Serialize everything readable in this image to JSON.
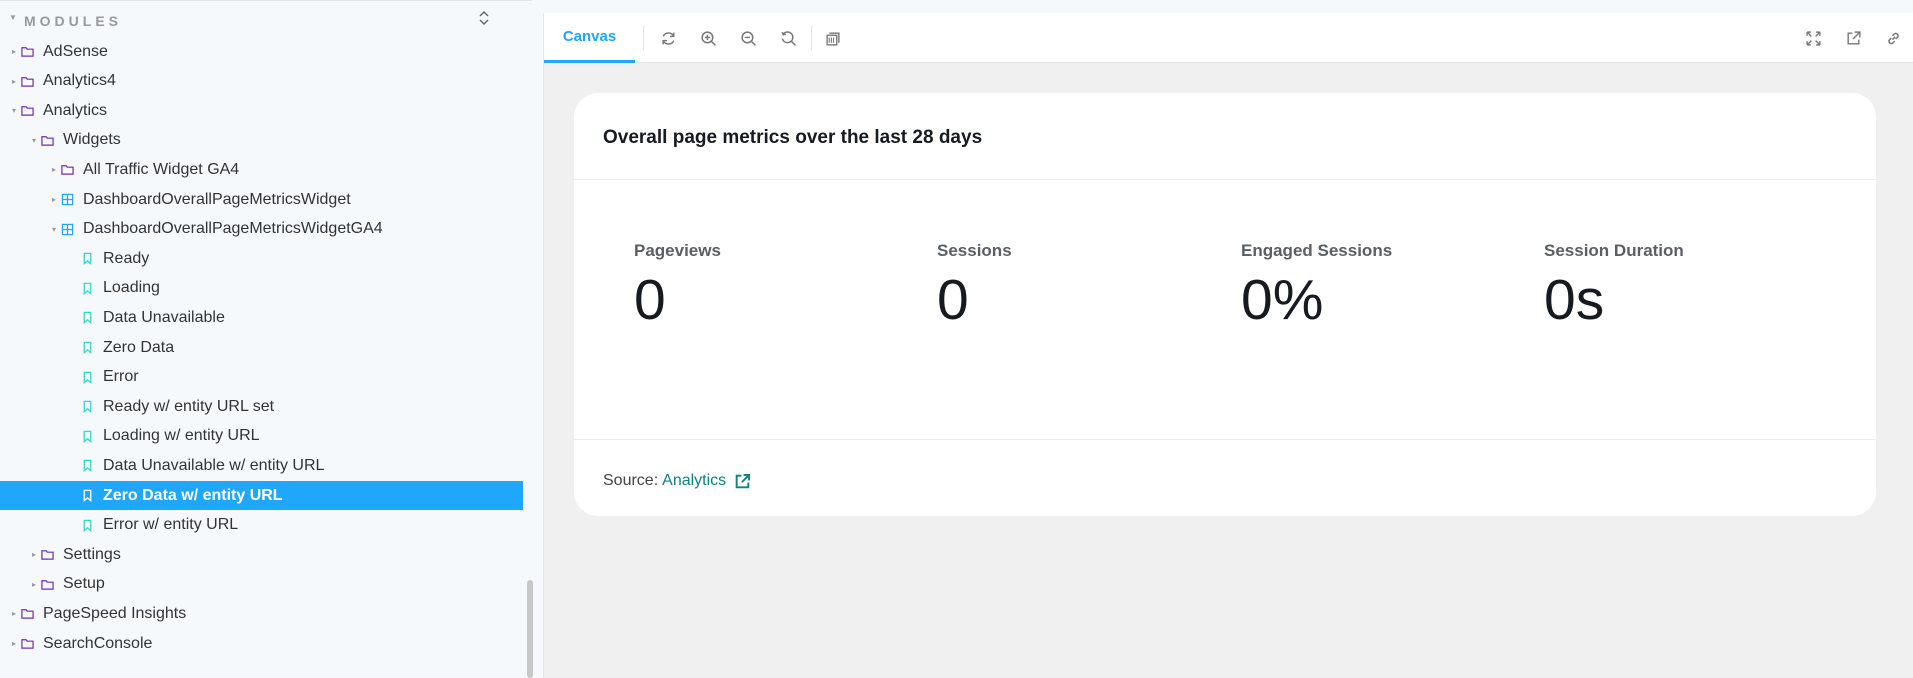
{
  "sidebar": {
    "section_title": "MODULES",
    "tree": [
      {
        "label": "AdSense",
        "icon": "folder-icon",
        "depth": 0,
        "caret": "right"
      },
      {
        "label": "Analytics4",
        "icon": "folder-icon",
        "depth": 0,
        "caret": "right"
      },
      {
        "label": "Analytics",
        "icon": "folder-icon",
        "depth": 0,
        "caret": "down"
      },
      {
        "label": "Widgets",
        "icon": "folder-icon",
        "depth": 1,
        "caret": "down"
      },
      {
        "label": "All Traffic Widget GA4",
        "icon": "folder-icon",
        "depth": 2,
        "caret": "right"
      },
      {
        "label": "DashboardOverallPageMetricsWidget",
        "icon": "component-icon",
        "depth": 2,
        "caret": "right"
      },
      {
        "label": "DashboardOverallPageMetricsWidgetGA4",
        "icon": "component-icon",
        "depth": 2,
        "caret": "down"
      },
      {
        "label": "Ready",
        "icon": "bookmark-icon",
        "depth": 3
      },
      {
        "label": "Loading",
        "icon": "bookmark-icon",
        "depth": 3
      },
      {
        "label": "Data Unavailable",
        "icon": "bookmark-icon",
        "depth": 3
      },
      {
        "label": "Zero Data",
        "icon": "bookmark-icon",
        "depth": 3
      },
      {
        "label": "Error",
        "icon": "bookmark-icon",
        "depth": 3
      },
      {
        "label": "Ready w/ entity URL set",
        "icon": "bookmark-icon",
        "depth": 3
      },
      {
        "label": "Loading w/ entity URL",
        "icon": "bookmark-icon",
        "depth": 3
      },
      {
        "label": "Data Unavailable w/ entity URL",
        "icon": "bookmark-icon",
        "depth": 3
      },
      {
        "label": "Zero Data w/ entity URL",
        "icon": "bookmark-icon",
        "depth": 3,
        "selected": true
      },
      {
        "label": "Error w/ entity URL",
        "icon": "bookmark-icon",
        "depth": 3
      },
      {
        "label": "Settings",
        "icon": "folder-icon",
        "depth": 1,
        "caret": "right"
      },
      {
        "label": "Setup",
        "icon": "folder-icon",
        "depth": 1,
        "caret": "right"
      },
      {
        "label": "PageSpeed Insights",
        "icon": "folder-icon",
        "depth": 0,
        "caret": "right"
      },
      {
        "label": "SearchConsole",
        "icon": "folder-icon",
        "depth": 0,
        "caret": "right"
      }
    ]
  },
  "toolbar": {
    "tab_label": "Canvas"
  },
  "widget": {
    "title": "Overall page metrics over the last 28 days",
    "metrics": [
      {
        "label": "Pageviews",
        "value": "0"
      },
      {
        "label": "Sessions",
        "value": "0"
      },
      {
        "label": "Engaged Sessions",
        "value": "0%"
      },
      {
        "label": "Session Duration",
        "value": "0s"
      }
    ],
    "source_prefix": "Source:",
    "source_link": "Analytics"
  },
  "colors": {
    "accent": "#1ea7fd",
    "folder": "#6f2da8",
    "component": "#1ea7fd",
    "bookmark": "#37d5d3",
    "link": "#108080"
  }
}
